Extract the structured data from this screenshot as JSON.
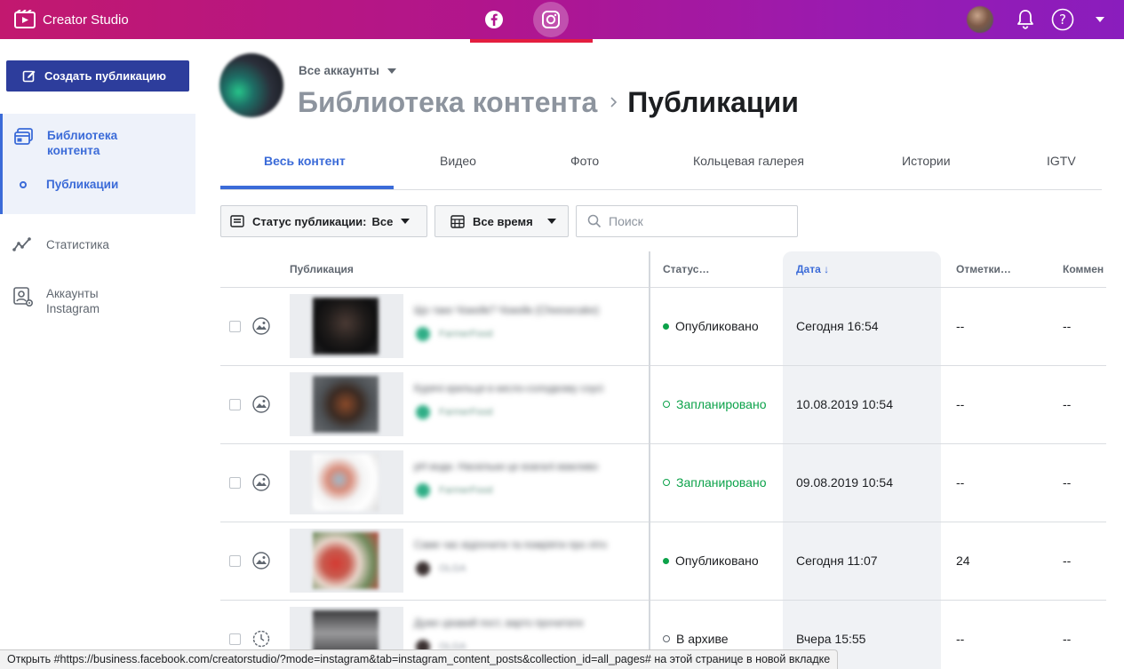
{
  "app": {
    "title": "Creator Studio",
    "platforms": [
      {
        "name": "Facebook",
        "icon": "facebook-icon"
      },
      {
        "name": "Instagram",
        "icon": "instagram-icon",
        "active": true
      }
    ]
  },
  "sidebar": {
    "create_label": "Создать публикацию",
    "library_label": "Библиотека контента",
    "posts_label": "Публикации",
    "stats_label": "Статистика",
    "accounts_label": "Аккаунты Instagram"
  },
  "header": {
    "account_selector": "Все аккаунты",
    "breadcrumb_parent": "Библиотека контента",
    "breadcrumb_current": "Публикации"
  },
  "tabs": [
    {
      "label": "Весь контент",
      "active": true
    },
    {
      "label": "Видео"
    },
    {
      "label": "Фото"
    },
    {
      "label": "Кольцевая галерея"
    },
    {
      "label": "Истории"
    },
    {
      "label": "IGTV"
    }
  ],
  "filters": {
    "status_label": "Статус публикации:",
    "status_value": "Все",
    "time_label": "Все время",
    "search_placeholder": "Поиск"
  },
  "table": {
    "columns": {
      "publication": "Публикация",
      "status": "Статус…",
      "date": "Дата ↓",
      "marks": "Отметки…",
      "comments": "Коммен"
    },
    "rows": [
      {
        "caption": "Що таке Чізкейк? Чізкейк (Cheesecake)",
        "account": "FarmerFood",
        "status": "Опубликовано",
        "status_type": "published",
        "date": "Сегодня 16:54",
        "marks": "--",
        "comments": "--",
        "type_icon": "photo-icon"
      },
      {
        "caption": "Курячі крильця в кисло-солодкому соусі",
        "account": "FarmerFood",
        "status": "Запланировано",
        "status_type": "scheduled",
        "date": "10.08.2019 10:54",
        "marks": "--",
        "comments": "--",
        "type_icon": "photo-icon"
      },
      {
        "caption": "pH води. Наскільки це взагалі важливо",
        "account": "FarmerFood",
        "status": "Запланировано",
        "status_type": "scheduled",
        "date": "09.08.2019 10:54",
        "marks": "--",
        "comments": "--",
        "type_icon": "photo-icon"
      },
      {
        "caption": "Саме час відпочити та помріяти про літо",
        "account": "OLGA",
        "status": "Опубликовано",
        "status_type": "published",
        "date": "Сегодня 11:07",
        "marks": "24",
        "comments": "--",
        "type_icon": "photo-icon"
      },
      {
        "caption": "Дуже цікавий пост, варто прочитати",
        "account": "OLGA",
        "status": "В архиве",
        "status_type": "archived",
        "date": "Вчера 15:55",
        "marks": "--",
        "comments": "--",
        "type_icon": "clock-icon"
      }
    ]
  },
  "status_url": "Открыть #https://business.facebook.com/creatorstudio/?mode=instagram&tab=instagram_content_posts&collection_id=all_pages# на этой странице в новой вкладке",
  "colors": {
    "accent": "#3b6bd8",
    "create_button": "#2d3d9c",
    "published": "#0ca24a",
    "topbar_start": "#c2186f",
    "topbar_end": "#8a1dbd"
  }
}
